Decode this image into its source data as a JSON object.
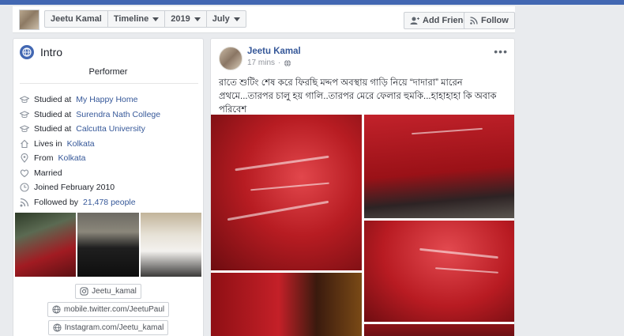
{
  "header": {
    "crumbs": [
      {
        "label": "Jeetu Kamal",
        "dropdown": false
      },
      {
        "label": "Timeline",
        "dropdown": true
      },
      {
        "label": "2019",
        "dropdown": true
      },
      {
        "label": "July",
        "dropdown": true
      }
    ],
    "add_friend_label": "Add Friend",
    "follow_label": "Follow"
  },
  "intro": {
    "title": "Intro",
    "bio": "Performer",
    "details": [
      {
        "icon": "graduation-cap-icon",
        "prefix": "Studied at ",
        "link": "My Happy Home",
        "suffix": ""
      },
      {
        "icon": "graduation-cap-icon",
        "prefix": "Studied at ",
        "link": "Surendra Nath College",
        "suffix": ""
      },
      {
        "icon": "graduation-cap-icon",
        "prefix": "Studied at ",
        "link": "Calcutta University",
        "suffix": ""
      },
      {
        "icon": "home-icon",
        "prefix": "Lives in ",
        "link": "Kolkata",
        "suffix": ""
      },
      {
        "icon": "location-pin-icon",
        "prefix": "From ",
        "link": "Kolkata",
        "suffix": ""
      },
      {
        "icon": "heart-icon",
        "prefix": "Married",
        "link": "",
        "suffix": ""
      },
      {
        "icon": "clock-icon",
        "prefix": "Joined February 2010",
        "link": "",
        "suffix": ""
      },
      {
        "icon": "rss-icon",
        "prefix": "Followed by ",
        "link": "21,478 people",
        "suffix": ""
      }
    ],
    "links": [
      {
        "icon": "instagram-icon",
        "label": "Jeetu_kamal"
      },
      {
        "icon": "globe-icon",
        "label": "mobile.twitter.com/JeetuPaul"
      },
      {
        "icon": "globe-icon",
        "label": "Instagram.com/Jeetu_kamal"
      }
    ]
  },
  "post": {
    "author": "Jeetu Kamal",
    "time": "17 mins",
    "privacy_icon": "globe-icon",
    "text": "রাতে শুটিং শেষ করে ফিরছি মদ্দপ অবস্থায় গাড়ি নিয়ে “দাদারা” মারেন প্রথমে...তারপর চালু হয় গালি..তারপর মেরে ফেলার হুমকি...হাহাহাহা কি অবাক পরিবেশ"
  },
  "colors": {
    "brand": "#4267b2",
    "link": "#365899",
    "page_bg": "#e9ebee"
  }
}
